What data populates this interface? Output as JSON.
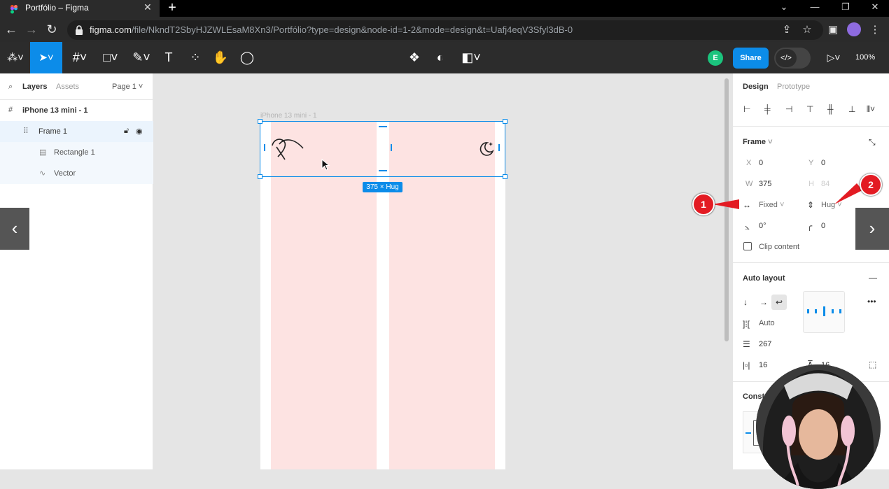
{
  "browser": {
    "tab_title": "Portfólio – Figma",
    "tab_close": "✕",
    "new_tab": "+",
    "url_host": "figma.com",
    "url_path": "/file/NkndT2SbyHJZWLEsaM8Xn3/Portfólio?type=design&node-id=1-2&mode=design&t=Uafj4eqV3Sfyl3dB-0"
  },
  "toolbar": {
    "share_label": "Share",
    "avatar_initial": "E",
    "zoom_label": "100%",
    "text_tool": "T"
  },
  "left_panel": {
    "tab_layers": "Layers",
    "tab_assets": "Assets",
    "page_select": "Page 1",
    "layers": [
      {
        "name": "iPhone 13 mini - 1"
      },
      {
        "name": "Frame 1"
      },
      {
        "name": "Rectangle 1"
      },
      {
        "name": "Vector"
      }
    ]
  },
  "canvas": {
    "frame_label": "iPhone 13 mini - 1",
    "size_badge": "375 × Hug"
  },
  "right_panel": {
    "tab_design": "Design",
    "tab_prototype": "Prototype",
    "frame_title": "Frame",
    "x_label": "X",
    "x_value": "0",
    "y_label": "Y",
    "y_value": "0",
    "w_label": "W",
    "w_value": "375",
    "h_label": "H",
    "h_value": "84",
    "horizontal_resizing": "Fixed",
    "vertical_resizing": "Hug",
    "rotation": "0°",
    "corner_radius": "0",
    "clip_content": "Clip content",
    "auto_layout_title": "Auto layout",
    "spacing_mode": "Auto",
    "spacing_value": "267",
    "padding_h": "16",
    "padding_v": "16",
    "constraints_title": "Const"
  },
  "annotations": {
    "marker1": "1",
    "marker2": "2"
  },
  "colors": {
    "accent": "#0c8ce9",
    "frame_fill": "#fde3e2",
    "marker_red": "#e31b23",
    "avatar_green": "#1bc47d"
  }
}
